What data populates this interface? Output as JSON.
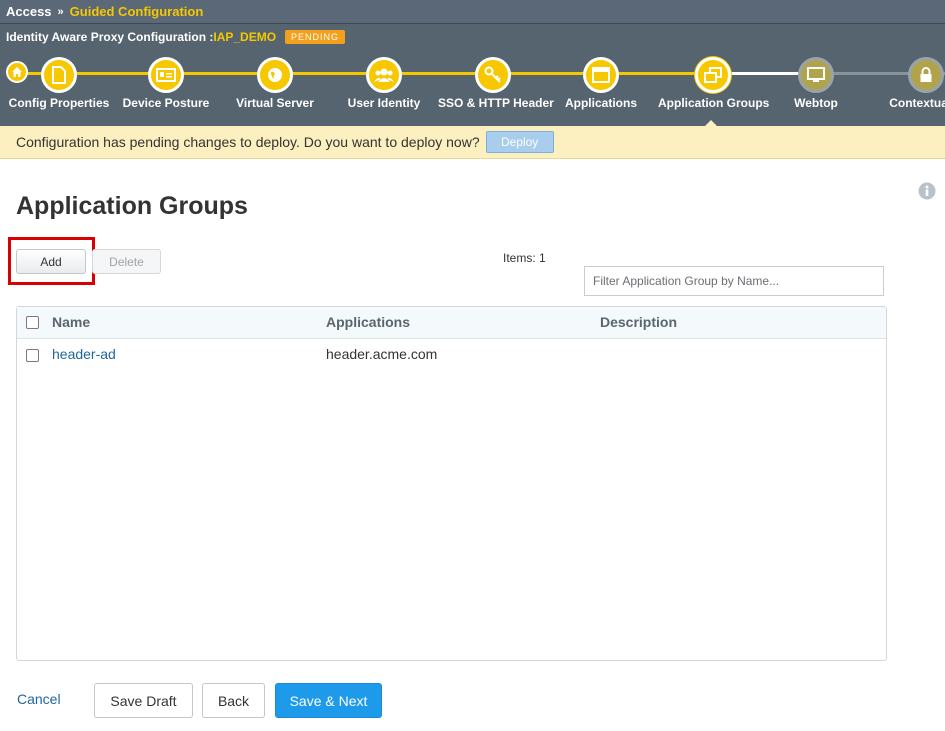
{
  "breadcrumb": {
    "root": "Access",
    "separator": "»",
    "current": "Guided Configuration"
  },
  "config": {
    "title_prefix": "Identity Aware Proxy Configuration :",
    "name": "IAP_DEMO",
    "status": "PENDING"
  },
  "steps": [
    {
      "label": "Config Properties",
      "icon": "document-icon"
    },
    {
      "label": "Device Posture",
      "icon": "id-card-icon"
    },
    {
      "label": "Virtual Server",
      "icon": "globe-icon"
    },
    {
      "label": "User Identity",
      "icon": "users-icon"
    },
    {
      "label": "SSO & HTTP Header",
      "icon": "key-icon"
    },
    {
      "label": "Applications",
      "icon": "window-icon"
    },
    {
      "label": "Application Groups",
      "icon": "windows-stack-icon",
      "active": true
    },
    {
      "label": "Webtop",
      "icon": "monitor-icon"
    },
    {
      "label": "Contextual A",
      "icon": "lock-icon"
    }
  ],
  "notice": {
    "message": "Configuration has pending changes to deploy. Do you want to deploy now?",
    "deploy_label": "Deploy"
  },
  "page": {
    "title": "Application Groups"
  },
  "toolbar": {
    "add_label": "Add",
    "delete_label": "Delete",
    "items_count": "Items: 1",
    "filter_placeholder": "Filter Application Group by Name..."
  },
  "table": {
    "columns": [
      "Name",
      "Applications",
      "Description"
    ],
    "rows": [
      {
        "name": "header-ad",
        "applications": "header.acme.com",
        "description": ""
      }
    ]
  },
  "footer": {
    "cancel_label": "Cancel",
    "save_draft_label": "Save Draft",
    "back_label": "Back",
    "save_next_label": "Save & Next"
  },
  "colors": {
    "accent": "#f7c800",
    "header_bg": "#56646f",
    "primary_button": "#1e9aeb",
    "highlight": "#d80000",
    "notice_bg": "#fcefc0"
  }
}
